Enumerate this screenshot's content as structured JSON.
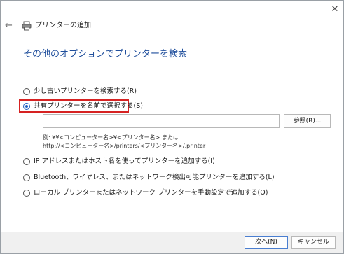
{
  "window": {
    "title": "プリンターの追加",
    "close_glyph": "✕",
    "back_glyph": "←"
  },
  "heading": "その他のオプションでプリンターを検索",
  "options": [
    {
      "label": "少し古いプリンターを検索する(R)",
      "checked": false
    },
    {
      "label": "共有プリンターを名前で選択する(S)",
      "checked": true
    },
    {
      "label": "IP アドレスまたはホスト名を使ってプリンターを追加する(I)",
      "checked": false
    },
    {
      "label": "Bluetooth、ワイヤレス、またはネットワーク検出可能プリンターを追加する(L)",
      "checked": false
    },
    {
      "label": "ローカル プリンターまたはネットワーク プリンターを手動設定で追加する(O)",
      "checked": false
    }
  ],
  "share_name": {
    "value": "",
    "browse_label": "参照(R)...",
    "example_line1": "例: ¥¥<コンピューター名>¥<プリンター名> または",
    "example_line2": "http://<コンピューター名>/printers/<プリンター名>/.printer"
  },
  "footer": {
    "next_label": "次へ(N)",
    "cancel_label": "キャンセル"
  },
  "colors": {
    "heading": "#1f4e9c",
    "highlight": "#d62222",
    "radio_checked": "#1f5fbf"
  }
}
